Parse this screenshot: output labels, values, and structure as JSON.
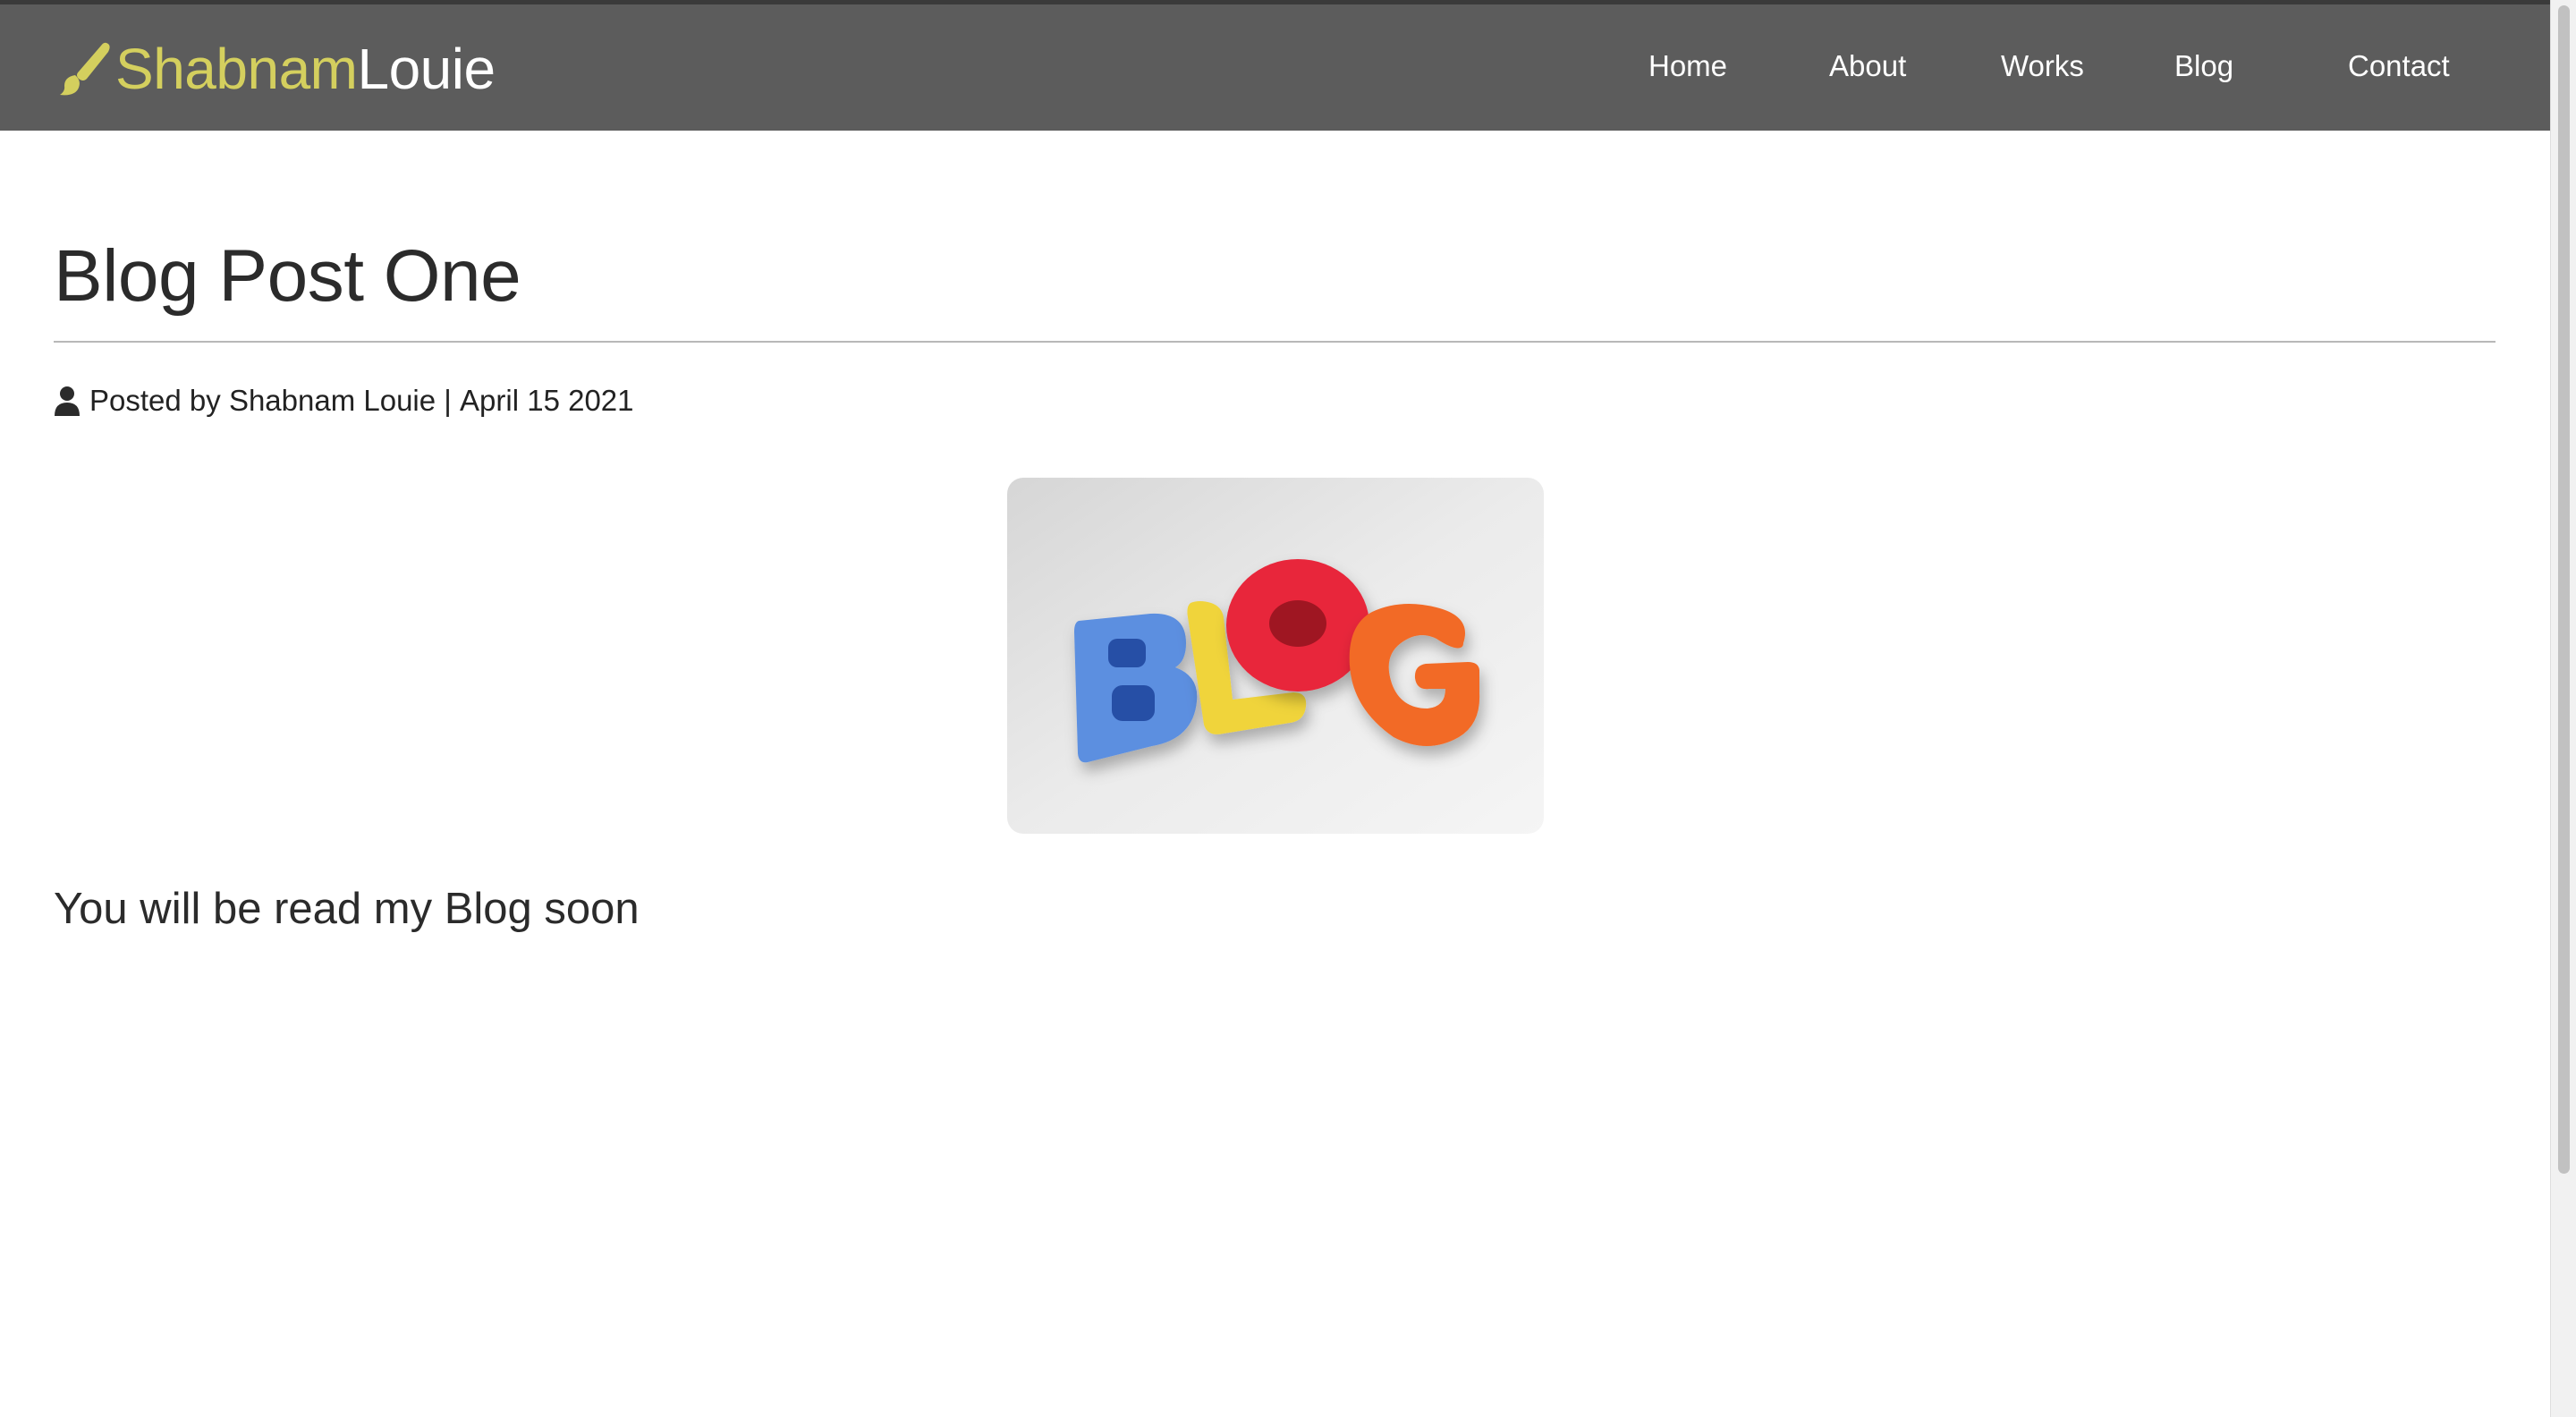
{
  "header": {
    "brand_first": "Shabnam",
    "brand_last": "Louie",
    "brand_icon": "paintbrush-icon",
    "nav": [
      "Home",
      "About",
      "Works",
      "Blog",
      "Contact"
    ]
  },
  "post": {
    "title": "Blog Post One",
    "meta_prefix": "Posted by ",
    "author": "Shabnam Louie",
    "separator": " | ",
    "date": "April 15 2021",
    "author_icon": "user-icon",
    "image_label": "BLOG",
    "body": "You will be read my Blog soon"
  },
  "colors": {
    "navbar_bg": "#5c5c5c",
    "brand_accent": "#d4cf5e",
    "text": "#2b2b2b"
  }
}
